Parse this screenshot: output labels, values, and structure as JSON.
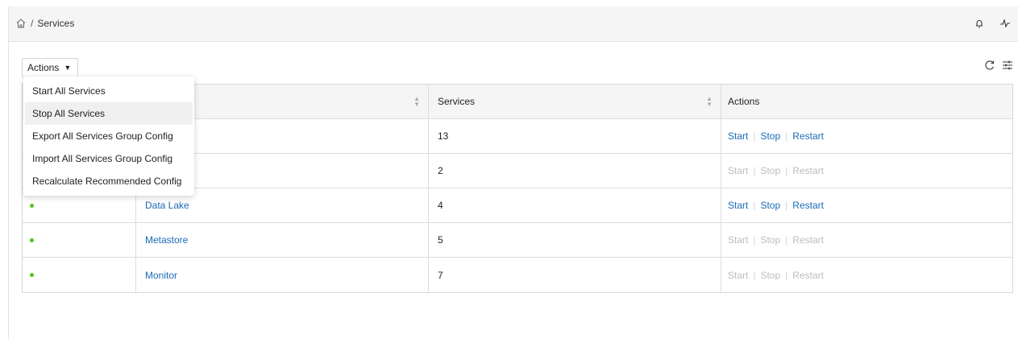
{
  "breadcrumb": {
    "current": "Services",
    "separator": "/"
  },
  "header_icons": [
    "bell-icon",
    "activity-icon"
  ],
  "toolbar": {
    "actions_label": "Actions",
    "actions_caret": "▼"
  },
  "tool_icons": [
    "refresh-icon",
    "column-settings-icon"
  ],
  "menu": {
    "items": [
      "Start All Services",
      "Stop All Services",
      "Export All Services Group Config",
      "Import All Services Group Config",
      "Recalculate Recommended Config"
    ],
    "highlighted_index": 1
  },
  "table": {
    "headers": {
      "group": "up",
      "services": "Services",
      "actions": "Actions"
    },
    "rows": [
      {
        "group": "",
        "services": "13",
        "enabled": true
      },
      {
        "group": "oker",
        "services": "2",
        "enabled": false
      },
      {
        "group": "Data Lake",
        "services": "4",
        "enabled": true
      },
      {
        "group": "Metastore",
        "services": "5",
        "enabled": false
      },
      {
        "group": "Monitor",
        "services": "7",
        "enabled": false
      }
    ],
    "action_labels": {
      "start": "Start",
      "stop": "Stop",
      "restart": "Restart"
    },
    "divider": "|"
  },
  "colors": {
    "status_ok": "#52c41a",
    "link": "#1a6bb8",
    "disabled": "#bdbdbd"
  }
}
